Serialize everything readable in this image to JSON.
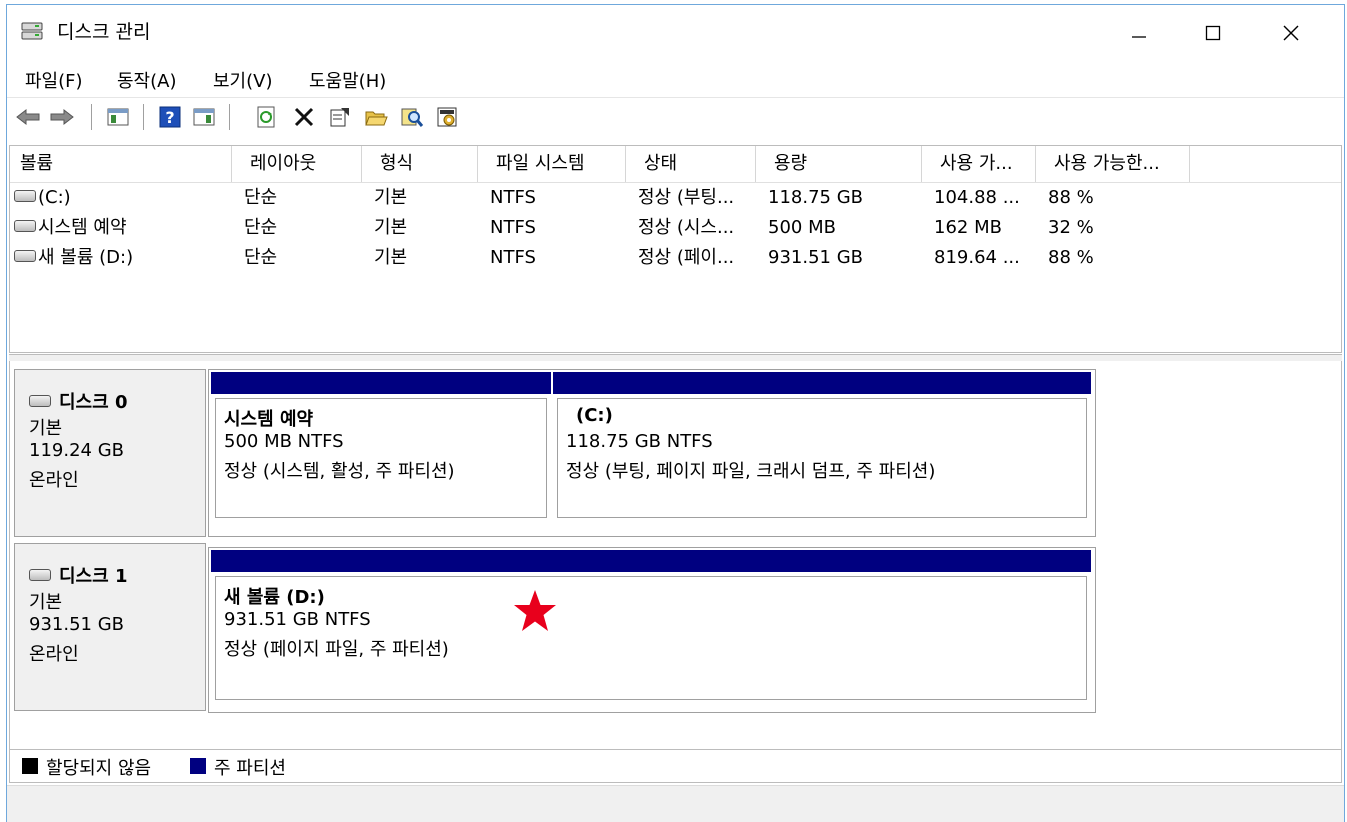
{
  "window": {
    "title": "디스크 관리",
    "controls": {
      "minimize": "minimize-icon",
      "maximize": "maximize-icon",
      "close": "close-icon"
    }
  },
  "menu": [
    "파일(F)",
    "동작(A)",
    "보기(V)",
    "도움말(H)"
  ],
  "toolbar": [
    "back-icon",
    "forward-icon",
    "console-tree-icon",
    "help-icon",
    "action-pane-icon",
    "refresh-icon",
    "delete-icon",
    "properties-icon",
    "open-icon",
    "rescan-icon",
    "settings-icon"
  ],
  "volume_table": {
    "columns": [
      "볼륨",
      "레이아웃",
      "형식",
      "파일 시스템",
      "상태",
      "용량",
      "사용 가...",
      "사용 가능한..."
    ],
    "rows": [
      [
        "(C:)",
        "단순",
        "기본",
        "NTFS",
        "정상 (부팅...",
        "118.75 GB",
        "104.88 ...",
        "88 %"
      ],
      [
        "시스템 예약",
        "단순",
        "기본",
        "NTFS",
        "정상 (시스...",
        "500 MB",
        "162 MB",
        "32 %"
      ],
      [
        "새 볼륨 (D:)",
        "단순",
        "기본",
        "NTFS",
        "정상 (페이...",
        "931.51 GB",
        "819.64 ...",
        "88 %"
      ]
    ]
  },
  "disks": [
    {
      "name": "디스크 0",
      "type": "기본",
      "size": "119.24 GB",
      "state": "온라인",
      "partitions": [
        {
          "title": "시스템 예약",
          "size_fs": "500 MB NTFS",
          "status": "정상 (시스템, 활성, 주 파티션)"
        },
        {
          "title": "(C:)",
          "size_fs": "118.75 GB NTFS",
          "status": "정상 (부팅, 페이지 파일, 크래시 덤프, 주 파티션)"
        }
      ]
    },
    {
      "name": "디스크 1",
      "type": "기본",
      "size": "931.51 GB",
      "state": "온라인",
      "partitions": [
        {
          "title": "새 볼륨  (D:)",
          "size_fs": "931.51 GB NTFS",
          "status": "정상 (페이지 파일, 주 파티션)"
        }
      ]
    }
  ],
  "legend": [
    {
      "label": "할당되지 않음",
      "color": "#000000"
    },
    {
      "label": "주 파티션",
      "color": "#000080"
    }
  ],
  "colors": {
    "primary_partition": "#000080",
    "star": "#e8001c",
    "accent_border": "#6fa8dc"
  }
}
